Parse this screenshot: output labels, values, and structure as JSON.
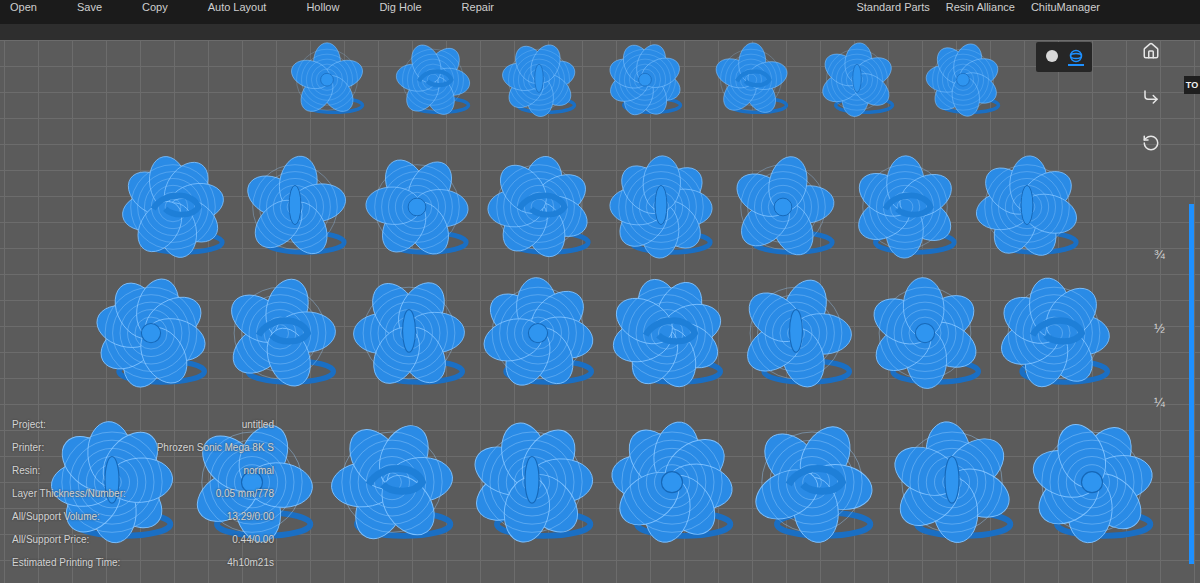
{
  "toolbar": {
    "left": [
      {
        "label": "Open"
      },
      {
        "label": "Save"
      },
      {
        "label": "Copy"
      },
      {
        "label": "Auto Layout"
      },
      {
        "label": "Hollow"
      },
      {
        "label": "Dig Hole"
      },
      {
        "label": "Repair"
      }
    ],
    "right": [
      {
        "label": "Standard Parts"
      },
      {
        "label": "Resin Alliance"
      },
      {
        "label": "ChituManager"
      }
    ]
  },
  "view_modes": [
    {
      "kind": "solid",
      "selected": false
    },
    {
      "kind": "wireframe",
      "selected": true
    }
  ],
  "side_tab": {
    "label": "TO"
  },
  "layer_slider": {
    "level": 1,
    "ticks": [
      "¾",
      "½",
      "¼"
    ]
  },
  "info": [
    {
      "label": "Project:",
      "value": "untitled"
    },
    {
      "label": "Printer:",
      "value": "Phrozen Sonic Mega 8K S"
    },
    {
      "label": "Resin:",
      "value": "normal"
    },
    {
      "label": "Layer Thickness/Number:",
      "value": "0.05 mm/778"
    },
    {
      "label": "All/Support Volume:",
      "value": "13.29/0.00"
    },
    {
      "label": "All/Support Price:",
      "value": "0.44/0.00"
    },
    {
      "label": "Estimated Printing Time:",
      "value": "4h10m21s"
    }
  ]
}
